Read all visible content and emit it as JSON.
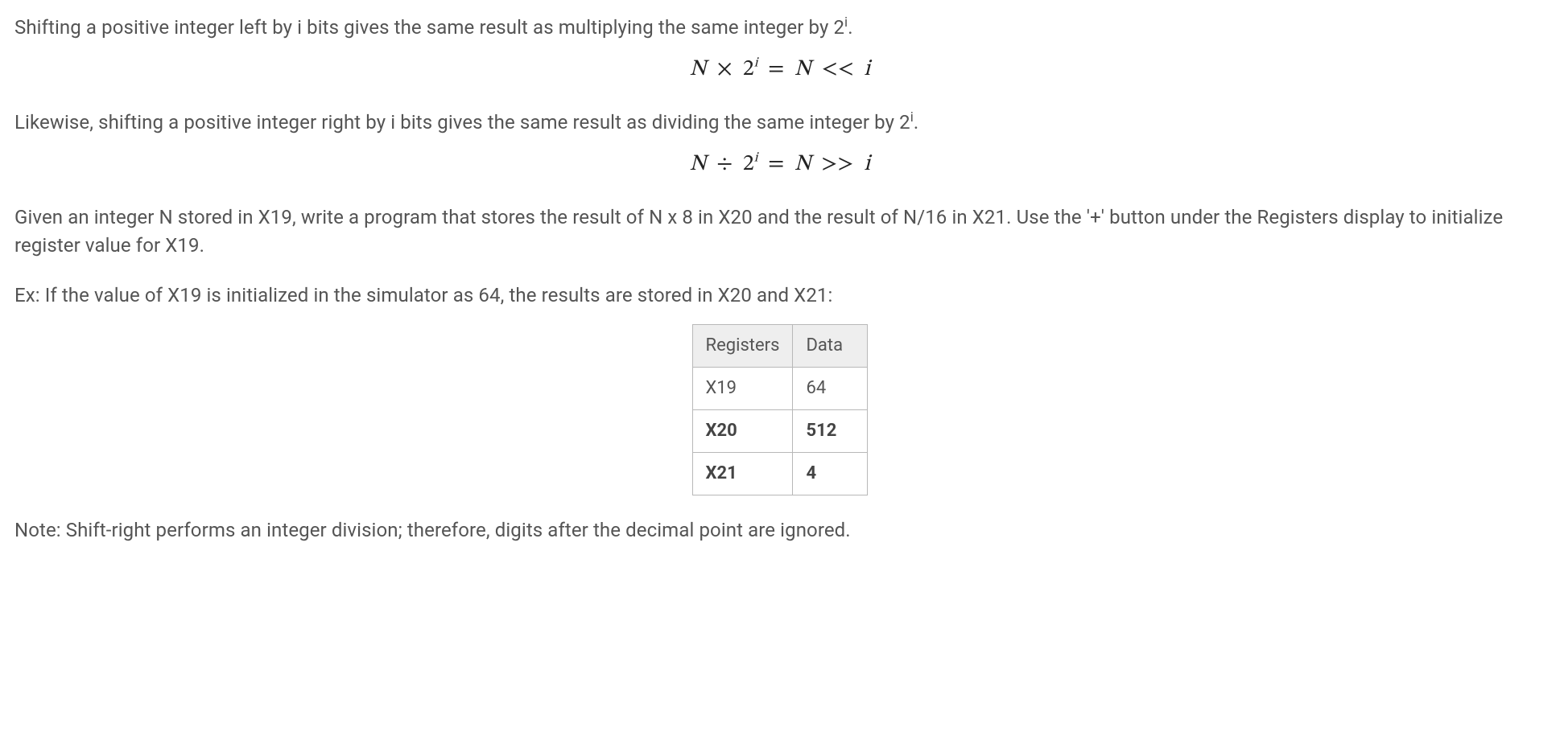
{
  "para1_a": "Shifting a positive integer left by i bits gives the same result as multiplying the same integer by 2",
  "para1_sup": "i",
  "para1_b": ".",
  "formula1": {
    "N": "N",
    "times": "×",
    "two": "2",
    "sup": "i",
    "eq": "=",
    "N2": "N",
    "shift": "<<",
    "i": "i"
  },
  "para2_a": "Likewise, shifting a positive integer right by i bits gives the same result as dividing the same integer by 2",
  "para2_sup": "i",
  "para2_b": ".",
  "formula2": {
    "N": "N",
    "div": "÷",
    "two": "2",
    "sup": "i",
    "eq": "=",
    "N2": "N",
    "shift": ">>",
    "i": "i"
  },
  "para3": "Given an integer N stored in X19, write a program that stores the result of N x 8 in X20 and the result of N/16 in X21. Use the '+' button under the Registers display to initialize register value for X19.",
  "para4": "Ex: If the value of X19 is initialized in the simulator as 64, the results are stored in X20 and X21:",
  "table": {
    "headers": {
      "col1": "Registers",
      "col2": "Data"
    },
    "rows": [
      {
        "reg": "X19",
        "val": "64",
        "bold": false
      },
      {
        "reg": "X20",
        "val": "512",
        "bold": true
      },
      {
        "reg": "X21",
        "val": "4",
        "bold": true
      }
    ]
  },
  "para5": "Note: Shift-right performs an integer division; therefore, digits after the decimal point are ignored."
}
